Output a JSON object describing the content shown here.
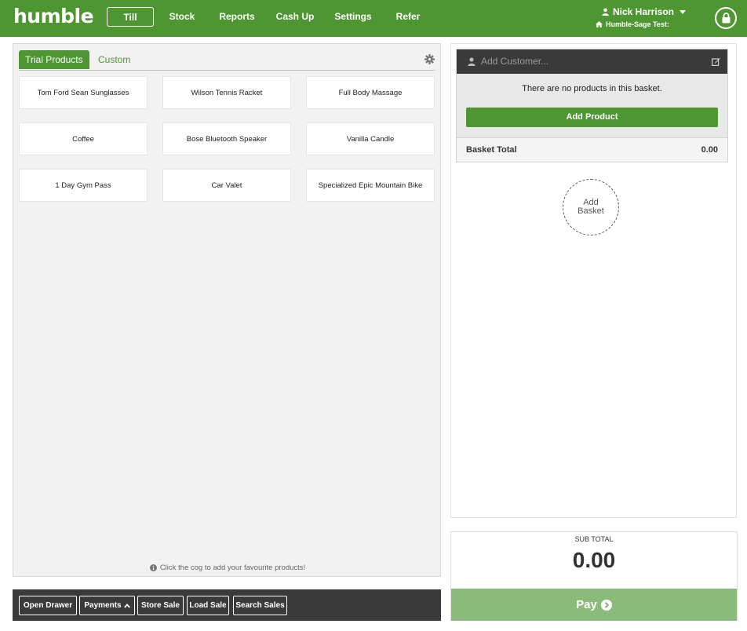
{
  "app": {
    "logo": "humble"
  },
  "nav": {
    "items": [
      {
        "label": "Till"
      },
      {
        "label": "Stock"
      },
      {
        "label": "Reports"
      },
      {
        "label": "Cash Up"
      },
      {
        "label": "Settings"
      },
      {
        "label": "Refer"
      }
    ]
  },
  "user": {
    "name": "Nick Harrison",
    "store": "Humble-Sage Test:"
  },
  "products": {
    "tabs": [
      {
        "label": "Trial Products"
      },
      {
        "label": "Custom"
      }
    ],
    "items": [
      {
        "label": "Tom Ford Sean Sunglasses"
      },
      {
        "label": "Wilson Tennis Racket"
      },
      {
        "label": "Full Body Massage"
      },
      {
        "label": "Coffee"
      },
      {
        "label": "Bose Bluetooth Speaker"
      },
      {
        "label": "Vanilla Candle"
      },
      {
        "label": "1 Day Gym Pass"
      },
      {
        "label": "Car Valet"
      },
      {
        "label": "Specialized Epic Mountain Bike"
      }
    ],
    "hint": "Click the cog to add your favourite products!"
  },
  "toolbar": {
    "open_drawer": "Open Drawer",
    "payments": "Payments",
    "store_sale": "Store Sale",
    "load_sale": "Load Sale",
    "search_sales": "Search Sales"
  },
  "basket": {
    "customer_placeholder": "Add Customer...",
    "empty_message": "There are no products in this basket.",
    "add_product": "Add Product",
    "total_label": "Basket Total",
    "total_value": "0.00",
    "add_basket_line1": "Add",
    "add_basket_line2": "Basket"
  },
  "summary": {
    "subtotal_label": "SUB TOTAL",
    "subtotal_value": "0.00",
    "pay_label": "Pay"
  },
  "colors": {
    "brand_green": "#4e9632",
    "pay_green": "#8bbb7b",
    "dark_bar": "#3a3a3a"
  }
}
